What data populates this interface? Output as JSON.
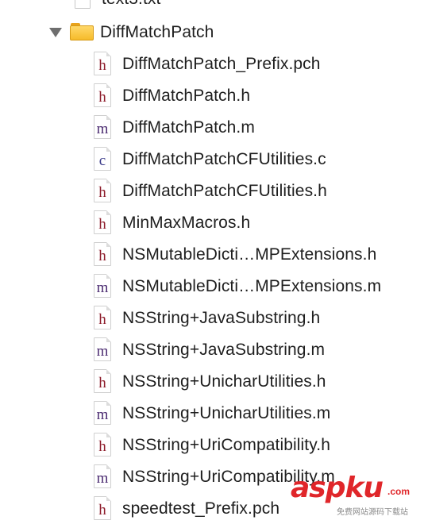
{
  "navigator": {
    "top_file": {
      "name": "text3.txt",
      "icon": "text-file-icon"
    },
    "folder": {
      "name": "DiffMatchPatch",
      "expanded": true,
      "icon": "folder-icon",
      "disclosure": "disclosure-triangle-expanded"
    },
    "files": [
      {
        "name": "DiffMatchPatch_Prefix.pch",
        "type": "h",
        "glyph": "h"
      },
      {
        "name": "DiffMatchPatch.h",
        "type": "h",
        "glyph": "h"
      },
      {
        "name": "DiffMatchPatch.m",
        "type": "m",
        "glyph": "m"
      },
      {
        "name": "DiffMatchPatchCFUtilities.c",
        "type": "c",
        "glyph": "c"
      },
      {
        "name": "DiffMatchPatchCFUtilities.h",
        "type": "h",
        "glyph": "h"
      },
      {
        "name": "MinMaxMacros.h",
        "type": "h",
        "glyph": "h"
      },
      {
        "name": "NSMutableDicti…MPExtensions.h",
        "type": "h",
        "glyph": "h"
      },
      {
        "name": "NSMutableDicti…MPExtensions.m",
        "type": "m",
        "glyph": "m"
      },
      {
        "name": "NSString+JavaSubstring.h",
        "type": "h",
        "glyph": "h"
      },
      {
        "name": "NSString+JavaSubstring.m",
        "type": "m",
        "glyph": "m"
      },
      {
        "name": "NSString+UnicharUtilities.h",
        "type": "h",
        "glyph": "h"
      },
      {
        "name": "NSString+UnicharUtilities.m",
        "type": "m",
        "glyph": "m"
      },
      {
        "name": "NSString+UriCompatibility.h",
        "type": "h",
        "glyph": "h"
      },
      {
        "name": "NSString+UriCompatibility.m",
        "type": "m",
        "glyph": "m"
      },
      {
        "name": "speedtest_Prefix.pch",
        "type": "h",
        "glyph": "h"
      }
    ]
  },
  "watermark": {
    "brand": "aspku",
    "tld": ".com",
    "tagline": "免费网站源码下载站"
  },
  "colors": {
    "folder": "#f6bb2a",
    "header_glyph": "#8d1b2a",
    "impl_glyph": "#4a2a70",
    "c_glyph": "#3b3b8a",
    "watermark": "#e0262a"
  }
}
